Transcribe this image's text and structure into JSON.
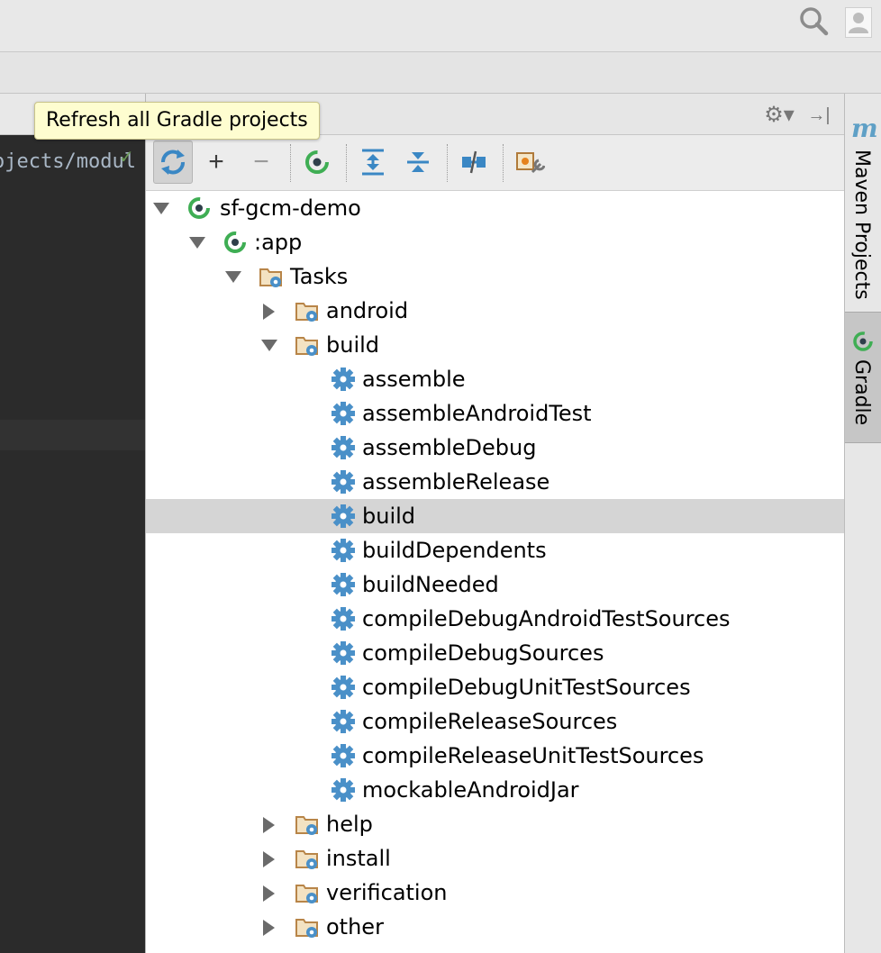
{
  "tooltip": {
    "text": "Refresh all Gradle projects"
  },
  "editor": {
    "path_fragment": "ojects/modul"
  },
  "toolbar": {
    "buttons": [
      {
        "name": "refresh-all-icon",
        "pressed": true
      },
      {
        "name": "add-icon",
        "glyph": "+"
      },
      {
        "name": "remove-icon",
        "glyph": "−"
      },
      {
        "name": "execute-gradle-task-icon"
      },
      {
        "name": "expand-all-icon"
      },
      {
        "name": "collapse-all-icon"
      },
      {
        "name": "toggle-offline-mode-icon"
      },
      {
        "name": "gradle-settings-icon"
      }
    ]
  },
  "tree": [
    {
      "label": "sf-gcm-demo",
      "level": 0,
      "icon": "gradle-project-icon",
      "arrow": "down"
    },
    {
      "label": ":app",
      "level": 1,
      "icon": "gradle-module-icon",
      "arrow": "down"
    },
    {
      "label": "Tasks",
      "level": 2,
      "icon": "tasks-folder-icon",
      "arrow": "down"
    },
    {
      "label": "android",
      "level": 3,
      "icon": "task-group-folder-icon",
      "arrow": "right"
    },
    {
      "label": "build",
      "level": 3,
      "icon": "task-group-folder-icon",
      "arrow": "down"
    },
    {
      "label": "assemble",
      "level": 4,
      "icon": "task-gear-icon"
    },
    {
      "label": "assembleAndroidTest",
      "level": 4,
      "icon": "task-gear-icon"
    },
    {
      "label": "assembleDebug",
      "level": 4,
      "icon": "task-gear-icon"
    },
    {
      "label": "assembleRelease",
      "level": 4,
      "icon": "task-gear-icon"
    },
    {
      "label": "build",
      "level": 4,
      "icon": "task-gear-icon",
      "selected": true
    },
    {
      "label": "buildDependents",
      "level": 4,
      "icon": "task-gear-icon"
    },
    {
      "label": "buildNeeded",
      "level": 4,
      "icon": "task-gear-icon"
    },
    {
      "label": "compileDebugAndroidTestSources",
      "level": 4,
      "icon": "task-gear-icon"
    },
    {
      "label": "compileDebugSources",
      "level": 4,
      "icon": "task-gear-icon"
    },
    {
      "label": "compileDebugUnitTestSources",
      "level": 4,
      "icon": "task-gear-icon"
    },
    {
      "label": "compileReleaseSources",
      "level": 4,
      "icon": "task-gear-icon"
    },
    {
      "label": "compileReleaseUnitTestSources",
      "level": 4,
      "icon": "task-gear-icon"
    },
    {
      "label": "mockableAndroidJar",
      "level": 4,
      "icon": "task-gear-icon"
    },
    {
      "label": "help",
      "level": 3,
      "icon": "task-group-folder-icon",
      "arrow": "right"
    },
    {
      "label": "install",
      "level": 3,
      "icon": "task-group-folder-icon",
      "arrow": "right"
    },
    {
      "label": "verification",
      "level": 3,
      "icon": "task-group-folder-icon",
      "arrow": "right"
    },
    {
      "label": "other",
      "level": 3,
      "icon": "task-group-folder-icon",
      "arrow": "right"
    }
  ],
  "side_tabs": {
    "maven": {
      "icon_letter": "m",
      "label": "Maven Projects"
    },
    "gradle": {
      "label": "Gradle"
    }
  },
  "colors": {
    "selection": "#d5d5d5",
    "gradle_green": "#3fae54",
    "task_blue": "#4a90c8",
    "folder_tan": "#c99a5e",
    "tooltip_bg": "#fefdd0"
  }
}
